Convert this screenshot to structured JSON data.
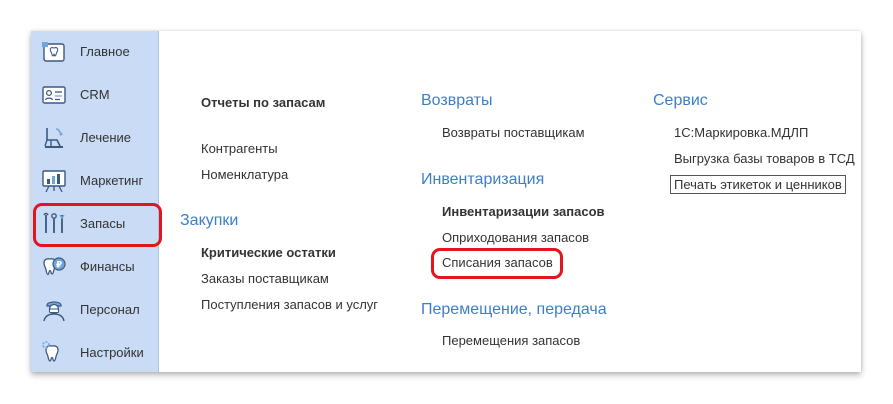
{
  "sidebar": {
    "items": [
      {
        "label": "Главное",
        "icon": "home-tooth-icon"
      },
      {
        "label": "CRM",
        "icon": "crm-card-icon"
      },
      {
        "label": "Лечение",
        "icon": "dental-chair-icon"
      },
      {
        "label": "Маркетинг",
        "icon": "marketing-board-icon"
      },
      {
        "label": "Запасы",
        "icon": "dental-tools-icon"
      },
      {
        "label": "Финансы",
        "icon": "tooth-coin-icon"
      },
      {
        "label": "Персонал",
        "icon": "doctor-icon"
      },
      {
        "label": "Настройки",
        "icon": "tooth-gear-icon"
      }
    ]
  },
  "col1": {
    "reports_title": "Отчеты по запасам",
    "counterparties": "Контрагенты",
    "nomenclature": "Номенклатура",
    "purchases_header": "Закупки",
    "critical_stock": "Критические остатки",
    "supplier_orders": "Заказы поставщикам",
    "receipts": "Поступления запасов и услуг"
  },
  "col2": {
    "returns_header": "Возвраты",
    "supplier_returns": "Возвраты поставщикам",
    "inventory_header": "Инвентаризация",
    "inventory_stock": "Инвентаризации запасов",
    "stock_postings": "Оприходования запасов",
    "stock_writeoffs": "Списания запасов",
    "transfer_header": "Перемещение, передача",
    "stock_transfers": "Перемещения запасов"
  },
  "col3": {
    "service_header": "Сервис",
    "marking": "1С:Маркировка.МДЛП",
    "export_tsd": "Выгрузка базы товаров в ТСД",
    "print_labels": "Печать этикеток и ценников"
  },
  "colors": {
    "sidebar_bg": "#c9dbf5",
    "header_blue": "#3c7fc8",
    "highlight_red": "#e3141b"
  }
}
